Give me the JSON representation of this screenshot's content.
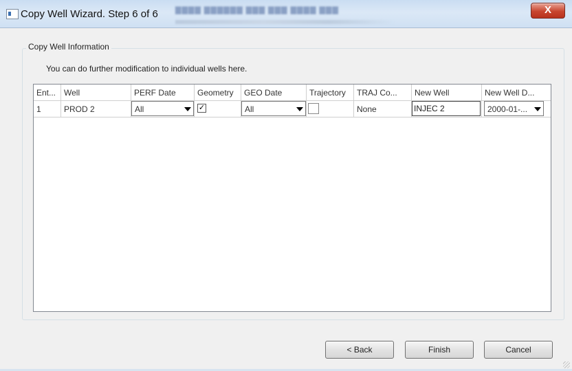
{
  "window": {
    "title": "Copy Well Wizard. Step 6 of 6",
    "close_glyph": "X"
  },
  "group": {
    "title": "Copy Well Information",
    "hint": "You can do further modification to individual wells here."
  },
  "grid": {
    "headers": [
      "Ent...",
      "Well",
      "PERF Date",
      "Geometry",
      "GEO Date",
      "Trajectory",
      "TRAJ Co...",
      "New Well",
      "New Well D..."
    ],
    "rows": [
      {
        "entry": "1",
        "well": "PROD 2",
        "perf_date": "All",
        "geometry_checked": true,
        "geo_date": "All",
        "trajectory_checked": false,
        "traj_co": "None",
        "new_well": "INJEC 2",
        "new_well_date": "2000-01-..."
      }
    ]
  },
  "buttons": {
    "back": "< Back",
    "finish": "Finish",
    "cancel": "Cancel"
  },
  "icons": {
    "app": "window-app-icon",
    "check": "✓"
  }
}
